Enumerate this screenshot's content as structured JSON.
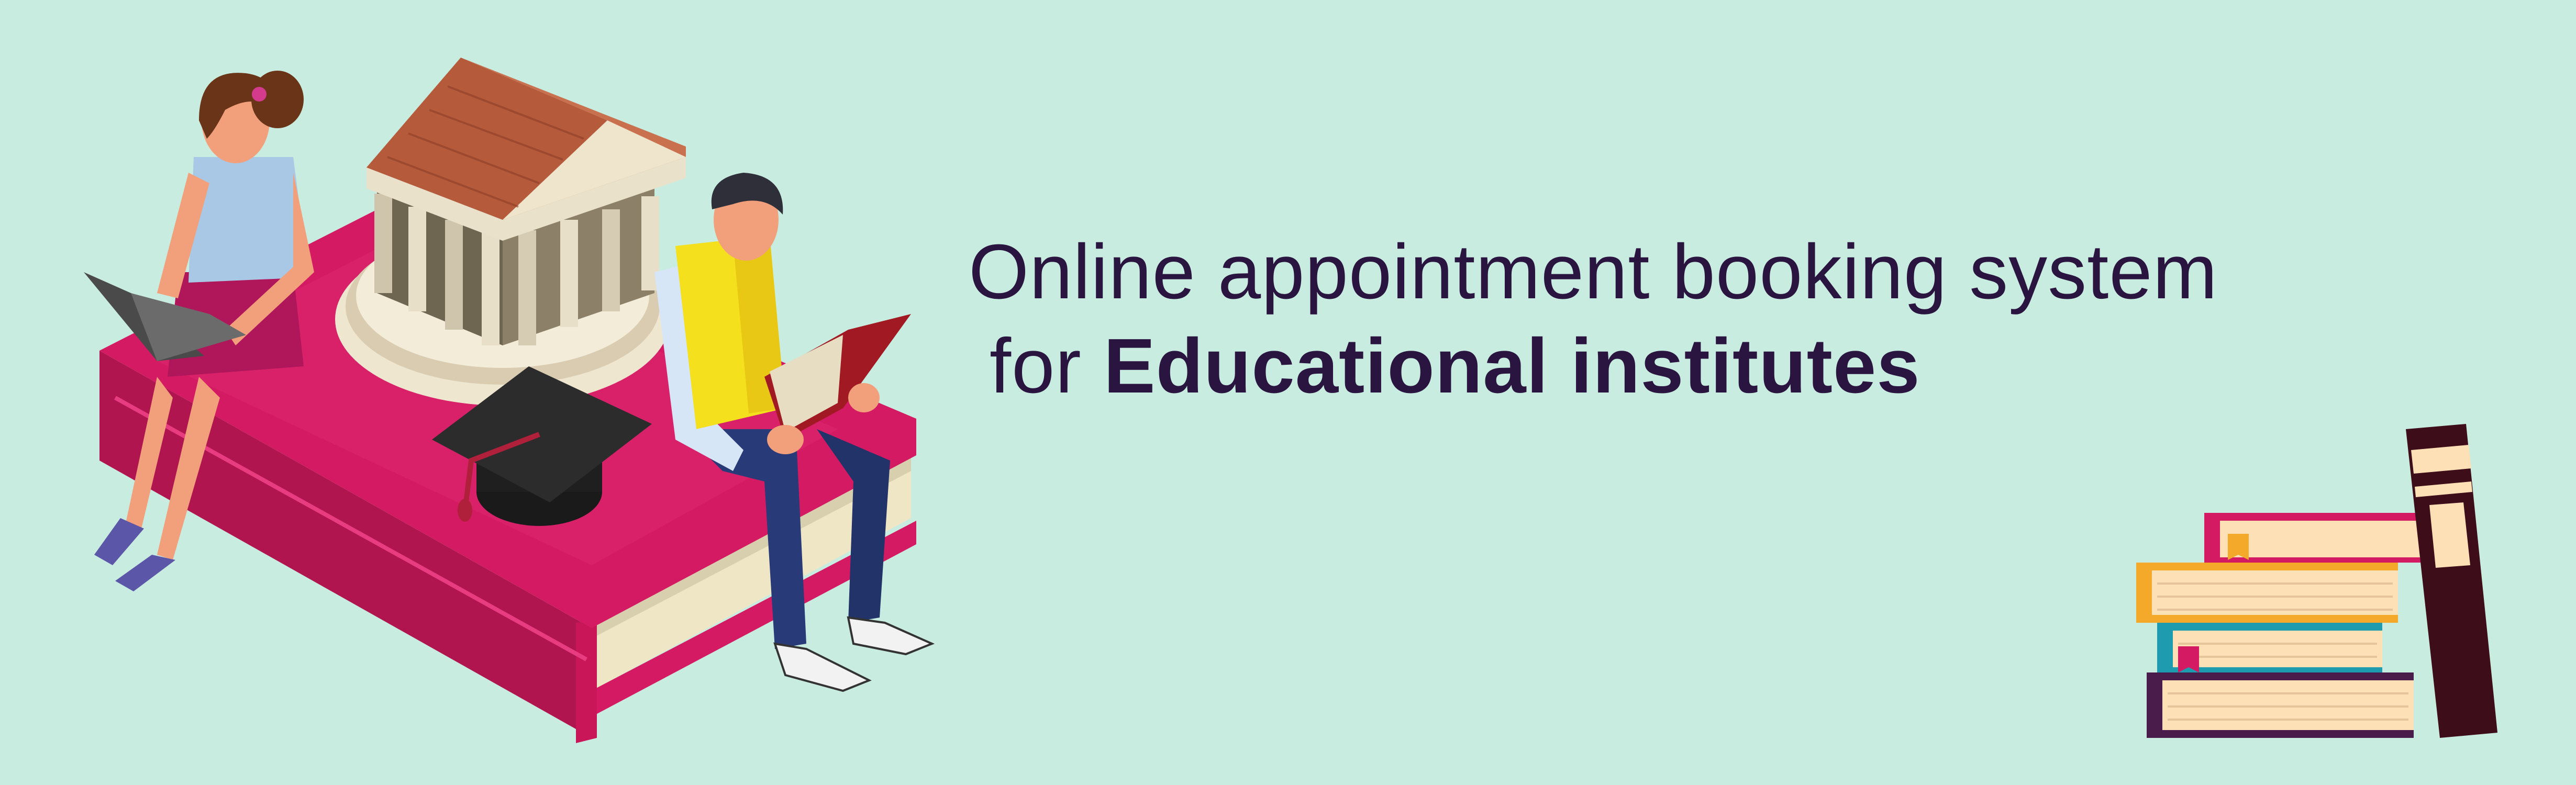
{
  "headline": {
    "line1": "Online appointment booking system",
    "line2_prefix": "for ",
    "line2_emphasis": "Educational institutes"
  },
  "colors": {
    "background": "#c8ecdf",
    "text": "#2a1540",
    "book_magenta": "#d41a62",
    "shirt_yellow": "#f4e01c",
    "trousers_navy": "#283a78"
  },
  "illustration": {
    "left_scene": "students-on-giant-book-with-university-building",
    "right_scene": "stack-of-books"
  }
}
